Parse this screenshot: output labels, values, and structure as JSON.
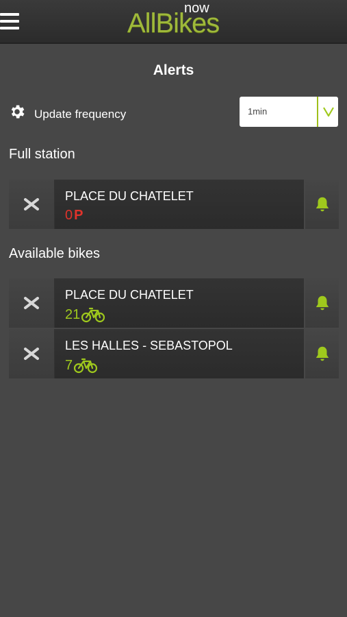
{
  "header": {
    "logo_main": "AllBikes",
    "logo_sup": "now"
  },
  "page": {
    "title": "Alerts"
  },
  "update": {
    "label": "Update frequency",
    "value": "1min"
  },
  "sections": {
    "full_station": {
      "title": "Full station",
      "items": [
        {
          "name": "PLACE DU CHATELET",
          "value": "0",
          "unit": "P"
        }
      ]
    },
    "available_bikes": {
      "title": "Available bikes",
      "items": [
        {
          "name": "PLACE DU CHATELET",
          "value": "21"
        },
        {
          "name": "LES HALLES - SEBASTOPOL",
          "value": "7"
        }
      ]
    }
  },
  "colors": {
    "accent_green": "#9fc91d",
    "alert_red": "#e0332b",
    "background": "#474747"
  },
  "icons": [
    "menu-icon",
    "gear-icon",
    "chevron-down-icon",
    "close-icon",
    "bell-icon",
    "bike-icon"
  ]
}
